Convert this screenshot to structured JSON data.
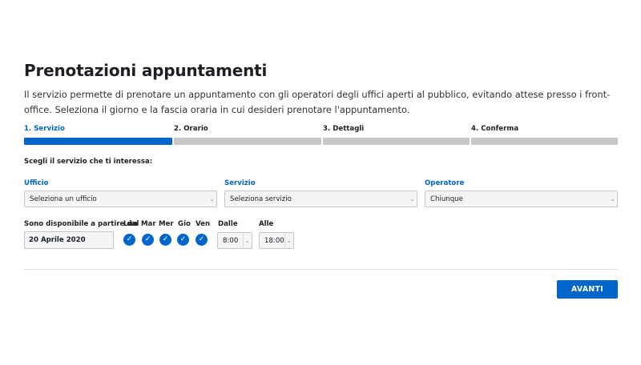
{
  "page": {
    "title": "Prenotazioni appuntamenti",
    "intro": "Il servizio permette di prenotare un appuntamento con gli operatori degli uffici aperti al pubblico, evitando attese presso i front-office. Seleziona il giorno e la fascia oraria in cui desideri prenotare l'appuntamento."
  },
  "steps": [
    {
      "label": "1. Servizio",
      "active": true
    },
    {
      "label": "2. Orario",
      "active": false
    },
    {
      "label": "3. Dettagli",
      "active": false
    },
    {
      "label": "4. Conferma",
      "active": false
    }
  ],
  "form": {
    "section_label": "Scegli il servizio che ti interessa:",
    "ufficio": {
      "label": "Ufficio",
      "value": "Seleziona un ufficio"
    },
    "servizio": {
      "label": "Servizio",
      "value": "Seleziona servizio"
    },
    "operatore": {
      "label": "Operatore",
      "value": "Chiunque"
    },
    "availability": {
      "label": "Sono disponibile a partire dal",
      "date": "20 Aprile 2020"
    },
    "days": [
      {
        "label": "Lun",
        "checked": true
      },
      {
        "label": "Mar",
        "checked": true
      },
      {
        "label": "Mer",
        "checked": true
      },
      {
        "label": "Gio",
        "checked": true
      },
      {
        "label": "Ven",
        "checked": true
      }
    ],
    "from": {
      "label": "Dalle",
      "value": "8:00"
    },
    "to": {
      "label": "Alle",
      "value": "18:00"
    }
  },
  "actions": {
    "next_label": "AVANTI"
  },
  "icons": {
    "check": "check-icon",
    "chevron": "chevron-updown-icon"
  },
  "colors": {
    "accent": "#0066cc",
    "inactive_step": "#c5c7c9"
  }
}
